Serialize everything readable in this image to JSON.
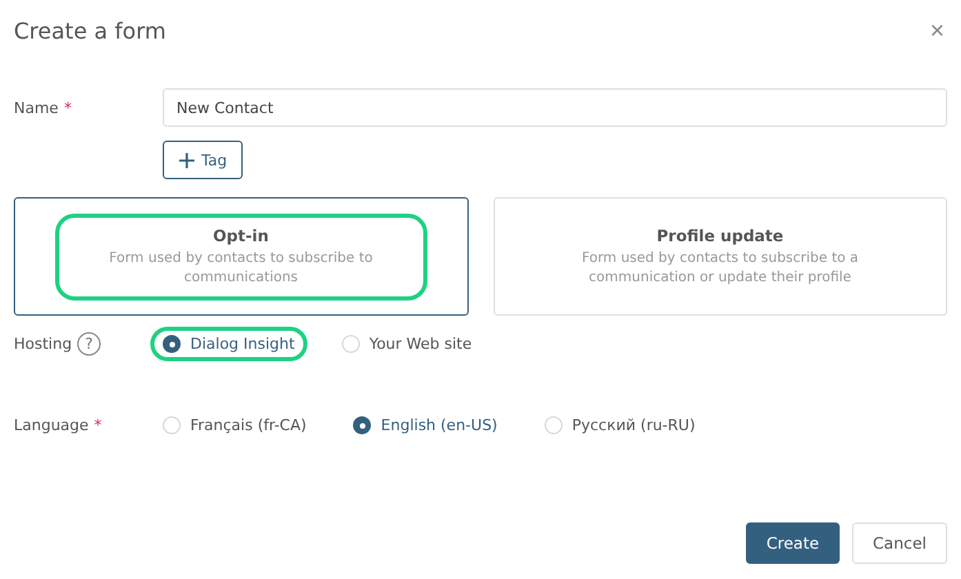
{
  "dialog": {
    "title": "Create a form",
    "close": "×"
  },
  "name_field": {
    "label": "Name",
    "required_mark": "*",
    "value": "New Contact"
  },
  "tag_button": {
    "label": "Tag"
  },
  "form_types": [
    {
      "title": "Opt-in",
      "description": "Form used by contacts to subscribe to communications",
      "selected": true,
      "highlighted": true
    },
    {
      "title": "Profile update",
      "description": "Form used by contacts to subscribe to a communication or update their profile",
      "selected": false,
      "highlighted": false
    }
  ],
  "hosting": {
    "label": "Hosting",
    "help": "?",
    "options": [
      {
        "label": "Dialog Insight",
        "selected": true,
        "highlighted": true
      },
      {
        "label": "Your Web site",
        "selected": false,
        "highlighted": false
      }
    ]
  },
  "language": {
    "label": "Language",
    "required_mark": "*",
    "options": [
      {
        "label": "Français (fr-CA)",
        "selected": false
      },
      {
        "label": "English (en-US)",
        "selected": true
      },
      {
        "label": "Русский (ru-RU)",
        "selected": false
      }
    ]
  },
  "buttons": [
    {
      "label": "Create",
      "kind": "primary"
    },
    {
      "label": "Cancel",
      "kind": "secondary"
    }
  ]
}
